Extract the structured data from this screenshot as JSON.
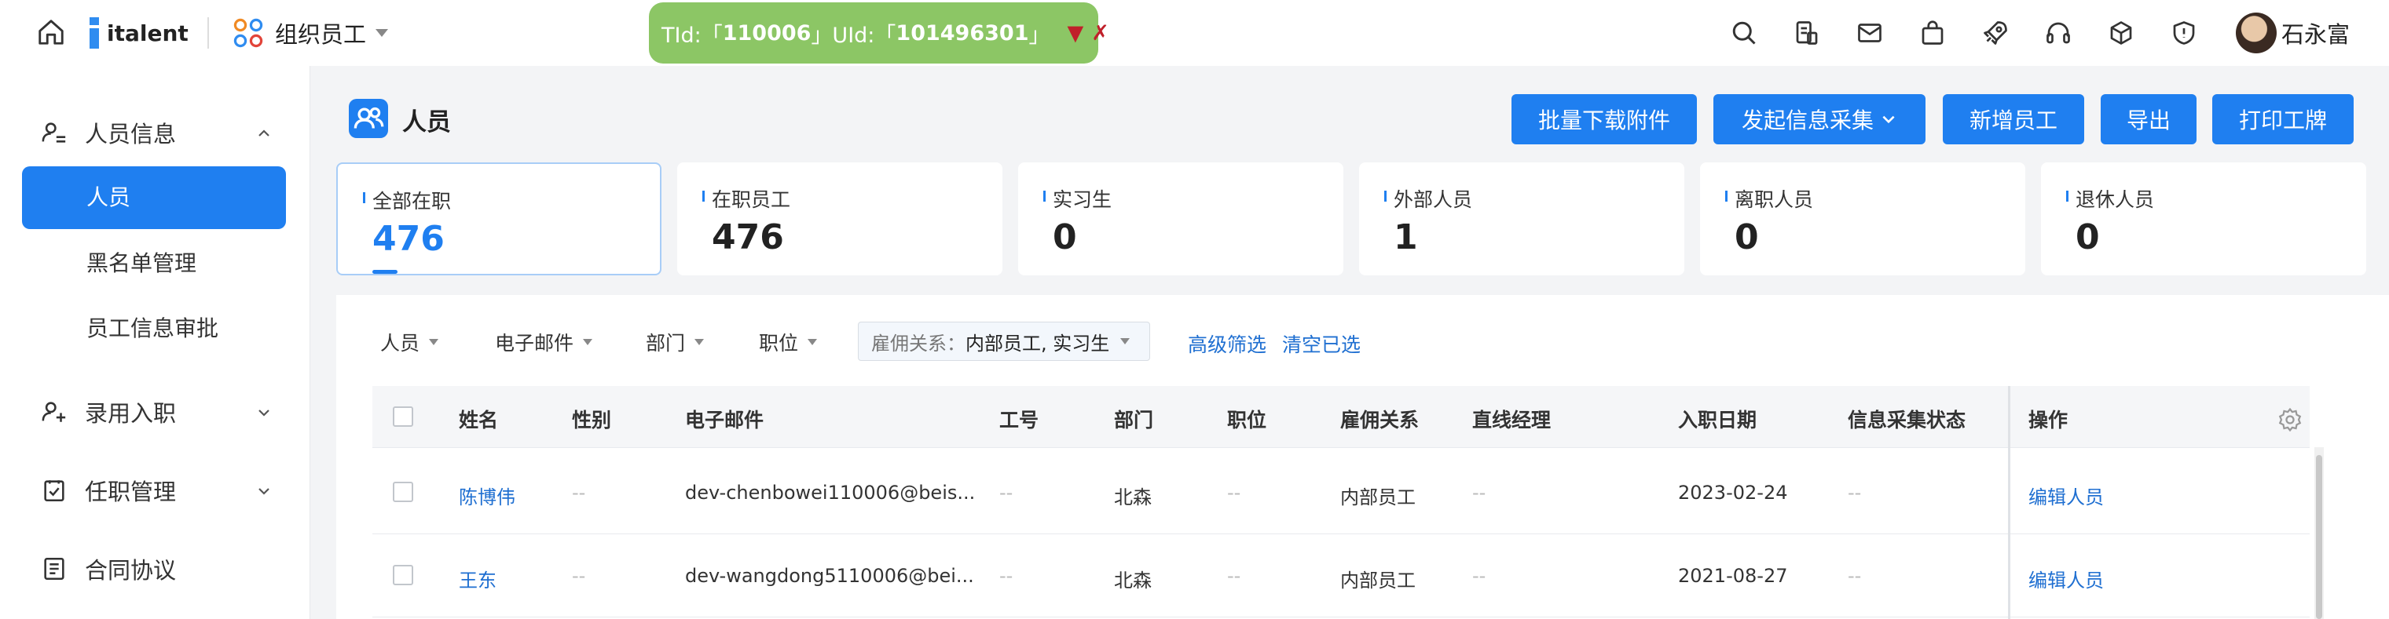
{
  "topbar": {
    "logo_text": "italent",
    "app_name": "组织员工",
    "tenant": {
      "tid_label": "TId:「",
      "tid_value": "110006",
      "uid_label": "」UId:「",
      "uid_value": "101496301",
      "uid_close": "」",
      "arrow": "▼",
      "close": "✗"
    },
    "user_name": "石永富",
    "icons": [
      "search-icon",
      "document-icon",
      "mail-icon",
      "bag-icon",
      "rocket-icon",
      "headset-icon",
      "cube-icon",
      "shield-icon"
    ]
  },
  "sidebar": {
    "groups": [
      {
        "label": "人员信息",
        "icon": "user-list-icon",
        "expanded": true
      },
      {
        "label": "录用入职",
        "icon": "user-add-icon",
        "expanded": false
      },
      {
        "label": "任职管理",
        "icon": "checklist-icon",
        "expanded": false
      },
      {
        "label": "合同协议",
        "icon": "contract-icon",
        "expanded": false
      }
    ],
    "items": [
      {
        "label": "人员",
        "active": true
      },
      {
        "label": "黑名单管理"
      },
      {
        "label": "员工信息审批"
      }
    ]
  },
  "main": {
    "title": "人员",
    "buttons": {
      "batch_download": "批量下载附件",
      "start_collect": "发起信息采集",
      "add_employee": "新增员工",
      "export": "导出",
      "print_badge": "打印工牌"
    },
    "stats": [
      {
        "label": "全部在职",
        "value": "476"
      },
      {
        "label": "在职员工",
        "value": "476"
      },
      {
        "label": "实习生",
        "value": "0"
      },
      {
        "label": "外部人员",
        "value": "1"
      },
      {
        "label": "离职人员",
        "value": "0"
      },
      {
        "label": "退休人员",
        "value": "0"
      }
    ],
    "filters": {
      "person": "人员",
      "email": "电子邮件",
      "department": "部门",
      "position": "职位",
      "employment_label": "雇佣关系：",
      "employment_value": "内部员工, 实习生",
      "advanced": "高级筛选",
      "clear": "清空已选"
    },
    "table": {
      "headers": {
        "name": "姓名",
        "gender": "性别",
        "email": "电子邮件",
        "emp_no": "工号",
        "dept": "部门",
        "position": "职位",
        "employment": "雇佣关系",
        "manager": "直线经理",
        "hire_date": "入职日期",
        "collect_status": "信息采集状态",
        "actions": "操作"
      },
      "rows": [
        {
          "name": "陈博伟",
          "gender": "--",
          "email": "dev-chenbowei110006@beis...",
          "emp_no": "--",
          "dept": "北森",
          "position": "--",
          "employment": "内部员工",
          "manager": "--",
          "hire_date": "2023-02-24",
          "collect_status": "--",
          "action": "编辑人员"
        },
        {
          "name": "王东",
          "gender": "--",
          "email": "dev-wangdong5110006@bei...",
          "emp_no": "--",
          "dept": "北森",
          "position": "--",
          "employment": "内部员工",
          "manager": "--",
          "hire_date": "2021-08-27",
          "collect_status": "--",
          "action": "编辑人员"
        }
      ]
    }
  }
}
